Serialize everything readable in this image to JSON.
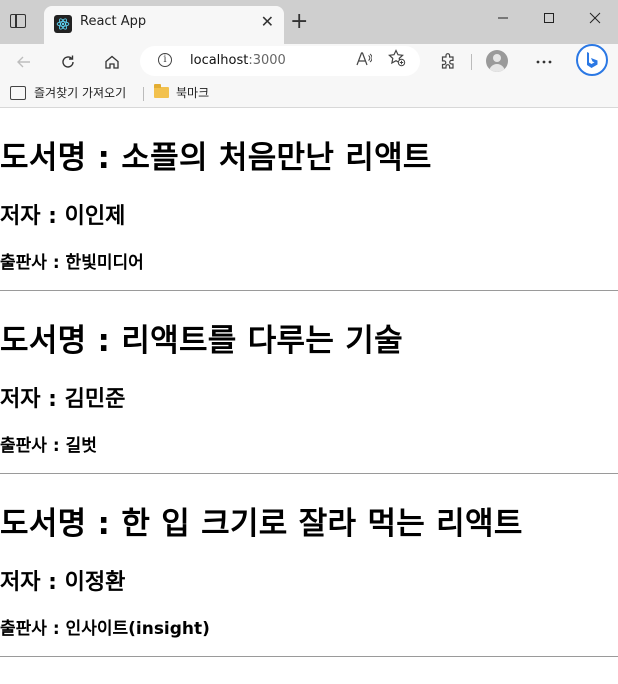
{
  "browser": {
    "tab_title": "React App",
    "tab_close": "✕",
    "new_tab": "+",
    "window_controls": {
      "minimize": "—",
      "maximize": "☐",
      "close": "✕"
    },
    "url_host": "localhost",
    "url_port": ":3000",
    "read_aloud_label": "Á",
    "favorites": [
      {
        "label": "즐겨찾기 가져오기",
        "icon": "import-favorites-icon"
      },
      {
        "label": "북마크",
        "icon": "folder-icon"
      }
    ],
    "accent_color": "#2b78e4"
  },
  "books": [
    {
      "title_label": "도서명 : 소플의 처음만난 리액트",
      "author_label": "저자 : 이인제",
      "publisher_label": "출판사 : 한빛미디어"
    },
    {
      "title_label": "도서명 : 리액트를 다루는 기술",
      "author_label": "저자 : 김민준",
      "publisher_label": "출판사 : 길벗"
    },
    {
      "title_label": "도서명 : 한 입 크기로 잘라 먹는 리액트",
      "author_label": "저자 : 이정환",
      "publisher_label": "출판사 : 인사이트(insight)"
    }
  ]
}
